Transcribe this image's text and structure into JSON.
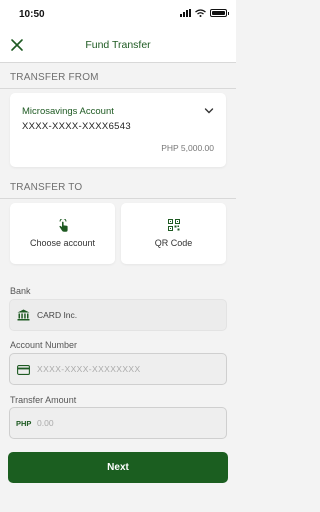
{
  "status_bar": {
    "time": "10:50"
  },
  "header": {
    "title": "Fund Transfer"
  },
  "transfer_from": {
    "section_label": "TRANSFER FROM",
    "account_name": "Microsavings Account",
    "account_number": "XXXX-XXXX-XXXX6543",
    "balance": "PHP 5,000.00"
  },
  "transfer_to": {
    "section_label": "TRANSFER TO",
    "options": [
      {
        "label": "Choose account",
        "icon": "tap-hand-icon"
      },
      {
        "label": "QR Code",
        "icon": "qr-code-icon"
      }
    ]
  },
  "bank": {
    "label": "Bank",
    "value": "CARD Inc.",
    "icon": "bank-icon"
  },
  "account_number": {
    "label": "Account Number",
    "placeholder": "XXXX-XXXX-XXXXXXXX",
    "icon": "card-icon"
  },
  "transfer_amount": {
    "label": "Transfer Amount",
    "currency": "PHP",
    "placeholder": "0.00"
  },
  "next_button": {
    "label": "Next"
  },
  "colors": {
    "brand_green": "#1b5e20",
    "background": "#f3f3f3"
  }
}
